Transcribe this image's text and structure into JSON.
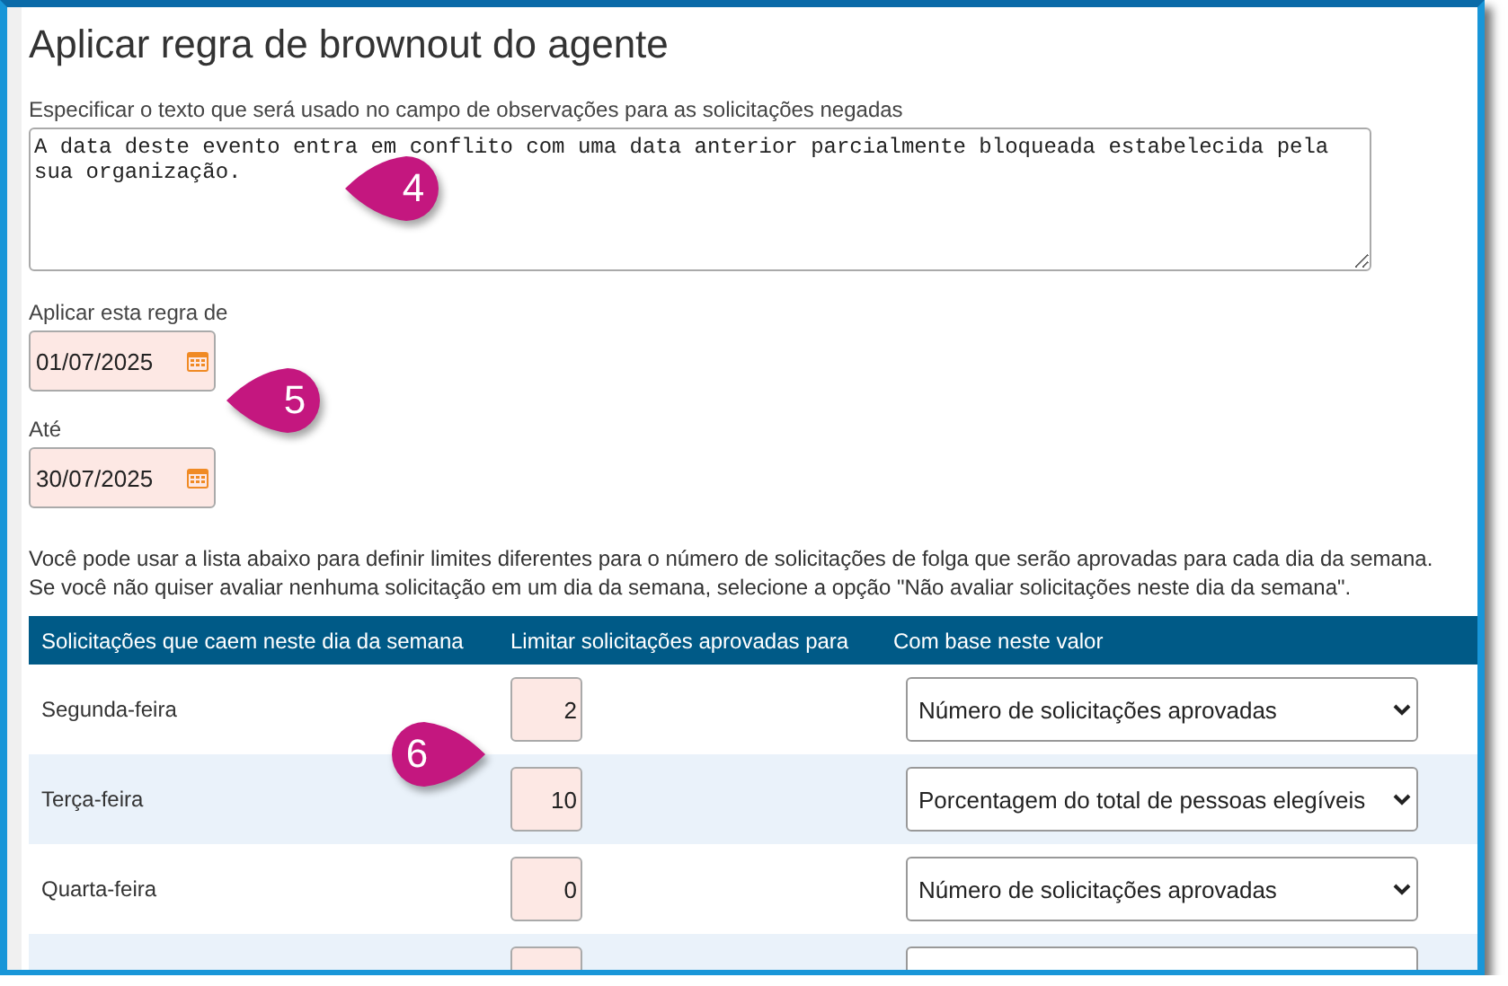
{
  "title": "Aplicar regra de brownout do agente",
  "note_field": {
    "label": "Especificar o texto que será usado no campo de observações para as solicitações negadas",
    "value": "A data deste evento entra em conflito com uma data anterior parcialmente bloqueada estabelecida pela sua organização."
  },
  "date_from": {
    "label": "Aplicar esta regra de",
    "value": "01/07/2025"
  },
  "date_to": {
    "label": "Até",
    "value": "30/07/2025"
  },
  "instructions": [
    "Você pode usar a lista abaixo para definir limites diferentes para o número de solicitações de folga que serão aprovadas para cada dia da semana.",
    "Se você não quiser avaliar nenhuma solicitação em um dia da semana, selecione a opção \"Não avaliar solicitações neste dia da semana\"."
  ],
  "table": {
    "columns": [
      "Solicitações que caem neste dia da semana",
      "Limitar solicitações aprovadas para",
      "Com base neste valor"
    ],
    "rows": [
      {
        "day": "Segunda-feira",
        "limit": "2",
        "basis": "Número de solicitações aprovadas"
      },
      {
        "day": "Terça-feira",
        "limit": "10",
        "basis": "Porcentagem do total de pessoas elegíveis"
      },
      {
        "day": "Quarta-feira",
        "limit": "0",
        "basis": "Número de solicitações aprovadas"
      }
    ],
    "more_rows_below": true
  },
  "callouts": [
    {
      "label": "4",
      "kind": "left"
    },
    {
      "label": "5",
      "kind": "left"
    },
    {
      "label": "6",
      "kind": "right"
    }
  ]
}
